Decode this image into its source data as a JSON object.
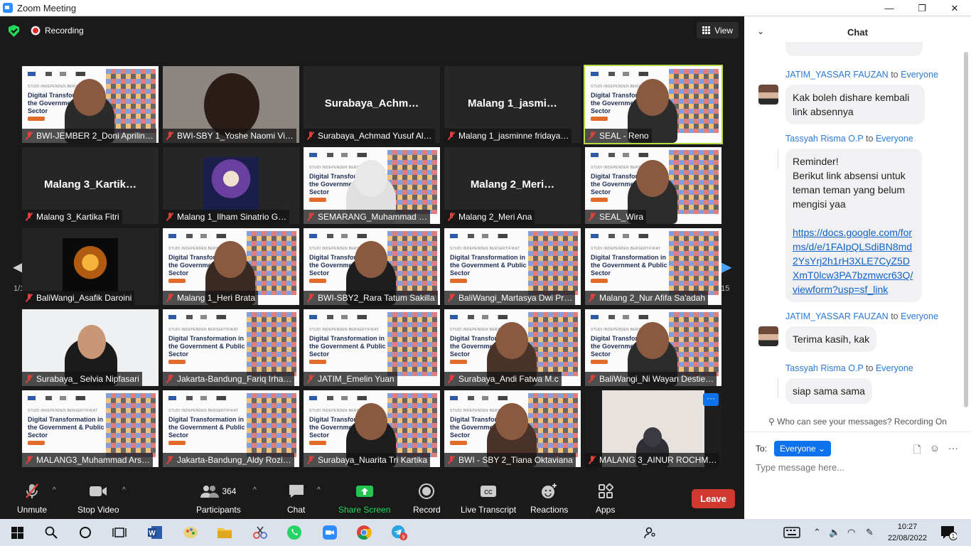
{
  "window": {
    "title": "Zoom Meeting",
    "minimize": "—",
    "restore": "❐",
    "close": "✕"
  },
  "meeting": {
    "recording_label": "Recording",
    "view_label": "View",
    "page_left": "1/15",
    "page_right": "1/15",
    "more_button": "···"
  },
  "tiles": [
    {
      "label": "BWI-JEMBER 2_Doni Aprilin…",
      "big": "",
      "style": "slide-person"
    },
    {
      "label": "BWI-SBY 1_Yoshe Naomi Vi…",
      "big": "",
      "style": "person-bg"
    },
    {
      "label": "Surabaya_Achmad Yusuf Al…",
      "big": "Surabaya_Achm…",
      "style": "name"
    },
    {
      "label": "Malang 1_jasminne fridaya…",
      "big": "Malang  1_jasmi…",
      "style": "name"
    },
    {
      "label": "SEAL - Reno",
      "big": "",
      "style": "slide-person-active"
    },
    {
      "label": "Malang 3_Kartika Fitri",
      "big": "Malang  3_Kartik…",
      "style": "name"
    },
    {
      "label": "Malang 1_Ilham Sinatrio G…",
      "big": "",
      "style": "astro"
    },
    {
      "label": "SEMARANG_Muhammad …",
      "big": "",
      "style": "slide-bear"
    },
    {
      "label": "Malang 2_Meri Ana",
      "big": "Malang  2_Meri…",
      "style": "name"
    },
    {
      "label": "SEAL_Wira",
      "big": "",
      "style": "slide-person"
    },
    {
      "label": "BaliWangi_Asafik Daroini",
      "big": "",
      "style": "cat"
    },
    {
      "label": "Malang 1_Heri Brata",
      "big": "",
      "style": "slide-person"
    },
    {
      "label": "BWI-SBY2_Rara Tatum Sakilla",
      "big": "",
      "style": "slide-person"
    },
    {
      "label": "BaliWangi_Martasya Dwi Pr…",
      "big": "",
      "style": "slide"
    },
    {
      "label": "Malang 2_Nur Afifa Sa'adah",
      "big": "",
      "style": "slide"
    },
    {
      "label": "Surabaya_ Selvia Nipfasari",
      "big": "",
      "style": "person-light"
    },
    {
      "label": "Jakarta-Bandung_Fariq Irha…",
      "big": "",
      "style": "slide"
    },
    {
      "label": "JATIM_Emelin Yuan",
      "big": "",
      "style": "slide"
    },
    {
      "label": "Surabaya_Andi Fatwa M.c",
      "big": "",
      "style": "slide-person"
    },
    {
      "label": "BaliWangi_Ni Wayan Destie…",
      "big": "",
      "style": "slide-person"
    },
    {
      "label": "MALANG3_Muhammad Ars…",
      "big": "",
      "style": "slide"
    },
    {
      "label": "Jakarta-Bandung_Aldy Rozi…",
      "big": "",
      "style": "slide"
    },
    {
      "label": "Surabaya_Nuarita Tri Kartika",
      "big": "",
      "style": "slide-person"
    },
    {
      "label": "BWI - SBY 2_Tiana Oktaviana",
      "big": "",
      "style": "slide-person"
    },
    {
      "label": "MALANG 3_AINUR ROCHM…",
      "big": "",
      "style": "room"
    }
  ],
  "slide": {
    "subtitle": "STUDI INDEPENDEN BERSERTIFIKAT",
    "title": "Digital Transformation in the Government & Public Sector"
  },
  "toolbar": {
    "unmute": "Unmute",
    "stop_video": "Stop Video",
    "participants": "Participants",
    "participants_count": "364",
    "chat": "Chat",
    "share_screen": "Share Screen",
    "record": "Record",
    "live_transcript": "Live Transcript",
    "reactions": "Reactions",
    "apps": "Apps",
    "leave": "Leave"
  },
  "chat": {
    "title": "Chat",
    "messages": [
      {
        "sender": "JATIM_YASSAR FAUZAN",
        "to": "to",
        "recipient": "Everyone",
        "text": "Kak boleh dishare kembali link absennya"
      },
      {
        "sender": "Tassyah Risma O.P",
        "to": "to",
        "recipient": "Everyone",
        "text": "Reminder!\nBerikut link absensi untuk teman teman yang belum mengisi yaa",
        "link": "https://docs.google.com/forms/d/e/1FAIpQLSdiBN8md2YsYrj2h1rH3XLE7CyZ5DXmT0lcw3PA7bzmwcr63Q/viewform?usp=sf_link"
      },
      {
        "sender": "JATIM_YASSAR FAUZAN",
        "to": "to",
        "recipient": "Everyone",
        "text": "Terima kasih, kak"
      },
      {
        "sender": "Tassyah Risma O.P",
        "to": "to",
        "recipient": "Everyone",
        "text": "siap sama sama"
      }
    ],
    "visibility_note": "Who can see your messages? Recording On",
    "to_label": "To:",
    "to_value": "Everyone",
    "input_placeholder": "Type message here..."
  },
  "taskbar": {
    "time": "10:27",
    "date": "22/08/2022",
    "notification_count": "1",
    "telegram_badge": "9"
  }
}
